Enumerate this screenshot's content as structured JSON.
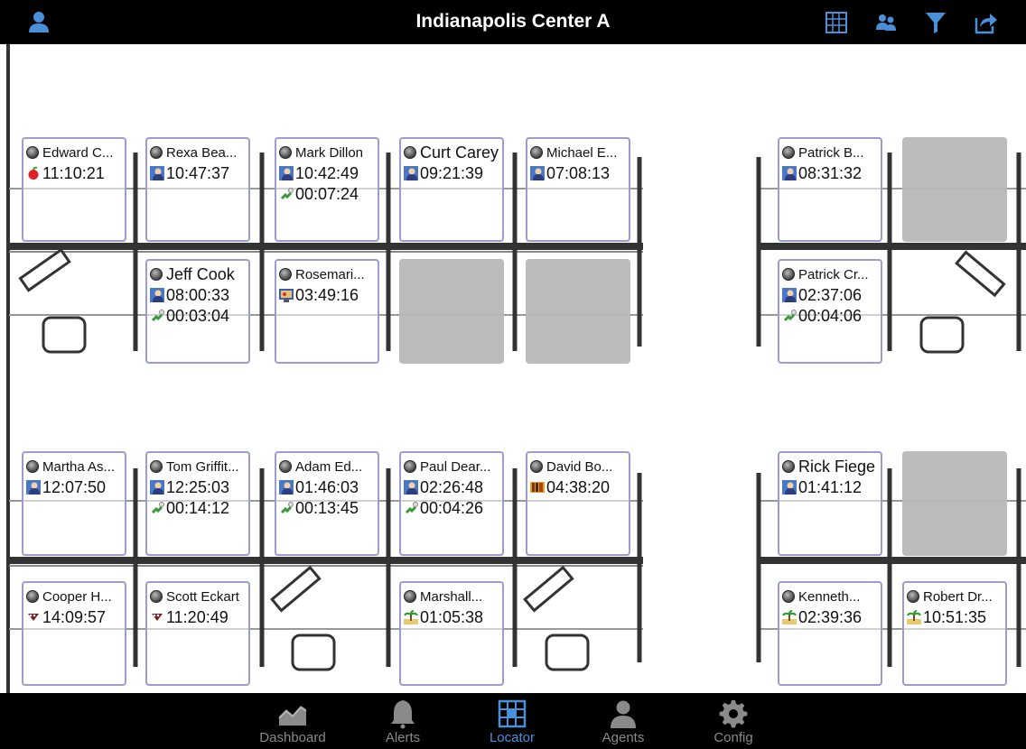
{
  "header": {
    "title": "Indianapolis Center A"
  },
  "tabs": [
    {
      "label": "Dashboard",
      "icon": "dashboard-icon",
      "active": false
    },
    {
      "label": "Alerts",
      "icon": "bell-icon",
      "active": false
    },
    {
      "label": "Locator",
      "icon": "grid-icon",
      "active": true
    },
    {
      "label": "Agents",
      "icon": "person-icon",
      "active": false
    },
    {
      "label": "Config",
      "icon": "gear-icon",
      "active": false
    }
  ],
  "colors": {
    "accent": "#4a90d9",
    "card_border": "#9c9cd0",
    "empty_seat": "#b8b8b8",
    "bar": "#000000"
  },
  "agents": [
    {
      "name": "Edward C...",
      "state_icon": "apple-icon",
      "time": "11:10:21"
    },
    {
      "name": "Rexa Bea...",
      "state_icon": "agent-phone-icon",
      "time": "10:47:37"
    },
    {
      "name": "Mark Dillon",
      "state_icon": "agent-phone-icon",
      "time": "10:42:49",
      "sub_icon": "handset-icon",
      "sub_time": "00:07:24"
    },
    {
      "name": "Curt Carey",
      "state_icon": "agent-phone-icon",
      "time": "09:21:39"
    },
    {
      "name": "Michael E...",
      "state_icon": "agent-phone-icon",
      "time": "07:08:13"
    },
    {
      "name": "Patrick B...",
      "state_icon": "agent-phone-icon",
      "time": "08:31:32"
    },
    {
      "name": "Jeff Cook",
      "state_icon": "agent-phone-icon",
      "time": "08:00:33",
      "sub_icon": "handset-icon",
      "sub_time": "00:03:04"
    },
    {
      "name": "Rosemari...",
      "state_icon": "computer-icon",
      "time": "03:49:16"
    },
    {
      "name": "Patrick Cr...",
      "state_icon": "agent-phone-icon",
      "time": "02:37:06",
      "sub_icon": "handset-icon",
      "sub_time": "00:04:06"
    },
    {
      "name": "Martha As...",
      "state_icon": "agent-phone-icon",
      "time": "12:07:50"
    },
    {
      "name": "Tom Griffit...",
      "state_icon": "agent-phone-icon",
      "time": "12:25:03",
      "sub_icon": "handset-icon",
      "sub_time": "00:14:12"
    },
    {
      "name": "Adam Ed...",
      "state_icon": "agent-phone-icon",
      "time": "01:46:03",
      "sub_icon": "handset-icon",
      "sub_time": "00:13:45"
    },
    {
      "name": "Paul Dear...",
      "state_icon": "agent-phone-icon",
      "time": "02:26:48",
      "sub_icon": "handset-icon",
      "sub_time": "00:04:26"
    },
    {
      "name": "David Bo...",
      "state_icon": "books-icon",
      "time": "04:38:20"
    },
    {
      "name": "Rick Fiege",
      "state_icon": "agent-phone-icon",
      "time": "01:41:12"
    },
    {
      "name": "Cooper H...",
      "state_icon": "coffee-icon",
      "time": "14:09:57"
    },
    {
      "name": "Scott Eckart",
      "state_icon": "coffee-icon",
      "time": "11:20:49"
    },
    {
      "name": "Marshall...",
      "state_icon": "palm-tree-icon",
      "time": "01:05:38"
    },
    {
      "name": "Kenneth...",
      "state_icon": "palm-tree-icon",
      "time": "02:39:36"
    },
    {
      "name": "Robert Dr...",
      "state_icon": "palm-tree-icon",
      "time": "10:51:35"
    }
  ]
}
